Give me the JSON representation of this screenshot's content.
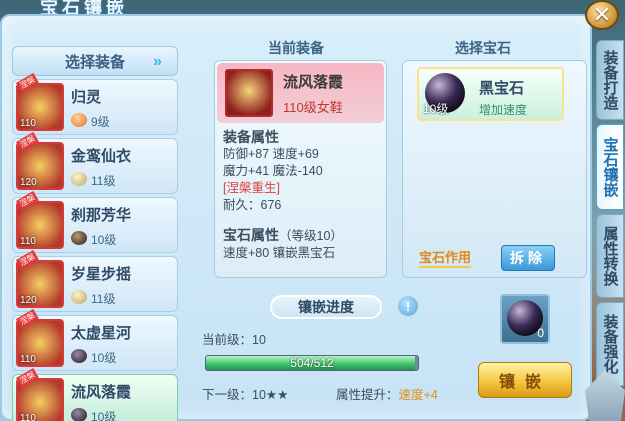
{
  "window": {
    "title": "宝石镶嵌",
    "close_label": "✕"
  },
  "left": {
    "header": "选择装备",
    "items": [
      {
        "name": "归灵",
        "equip_level": "110",
        "gem_level": "9级",
        "gem_color": "orange",
        "tag": "涅槃"
      },
      {
        "name": "金鸾仙衣",
        "equip_level": "120",
        "gem_level": "11级",
        "gem_color": "gold",
        "tag": "涅槃"
      },
      {
        "name": "刹那芳华",
        "equip_level": "110",
        "gem_level": "10级",
        "gem_color": "darkbrown",
        "tag": "涅槃"
      },
      {
        "name": "岁星步摇",
        "equip_level": "120",
        "gem_level": "11级",
        "gem_color": "gold",
        "tag": "涅槃"
      },
      {
        "name": "太虚星河",
        "equip_level": "110",
        "gem_level": "10级",
        "gem_color": "dark",
        "tag": "涅槃"
      },
      {
        "name": "流风落霞",
        "equip_level": "110",
        "gem_level": "10级",
        "gem_color": "dark",
        "tag": "涅槃"
      }
    ],
    "selected_index": 5
  },
  "current_equip": {
    "section_title": "当前装备",
    "name": "流风落霞",
    "subtitle": "110级女鞋",
    "attr_header": "装备属性",
    "attr_line1": "防御+87 速度+69",
    "attr_line2": "魔力+41 魔法-140",
    "attr_special": "[涅槃重生]",
    "durability": "耐久：676",
    "gem_attr_header": "宝石属性",
    "gem_attr_header_suffix": "（等级10）",
    "gem_attr_line": "速度+80 镶嵌黑宝石"
  },
  "gem_select": {
    "section_title": "选择宝石",
    "gem_name": "黑宝石",
    "gem_desc": "增加速度",
    "gem_level": "10级",
    "effect_link": "宝石作用",
    "remove_label": "拆除"
  },
  "progress": {
    "title": "镶嵌进度",
    "help": "!",
    "current_level": "当前级：10",
    "current": 504,
    "max": 512,
    "bar_text": "504/512",
    "next_level": "下一级：10★★",
    "attr_up_label": "属性提升：",
    "attr_up_value": "速度+4"
  },
  "slot": {
    "count": "0"
  },
  "inlay_button": "镶嵌",
  "tabs": [
    {
      "label": "装备打造",
      "active": false
    },
    {
      "label": "宝石镶嵌",
      "active": true
    },
    {
      "label": "属性转换",
      "active": false
    },
    {
      "label": "装备强化",
      "active": false
    }
  ]
}
